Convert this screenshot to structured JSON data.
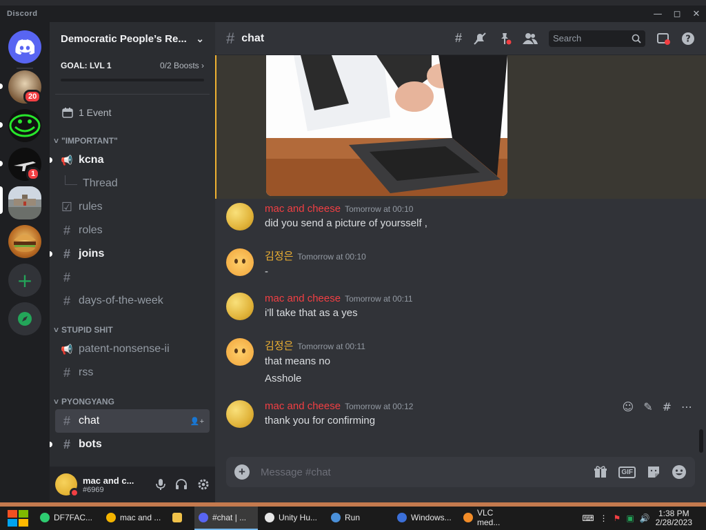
{
  "window": {
    "app_name": "Discord",
    "controls": [
      "minimize",
      "maximize",
      "close"
    ]
  },
  "rail": {
    "servers": [
      {
        "name": "server-1",
        "badge": "20"
      },
      {
        "name": "server-2"
      },
      {
        "name": "server-3",
        "badge": "1"
      },
      {
        "name": "server-4"
      },
      {
        "name": "server-5"
      }
    ]
  },
  "sidebar": {
    "server_name": "Democratic People’s Re...",
    "goal": {
      "label": "GOAL: LVL 1",
      "boosts": "0/2 Boosts",
      "progress": 0
    },
    "event": "1 Event",
    "categories": [
      {
        "name": "\"IMPORTANT\"",
        "channels": [
          {
            "name": "kcna",
            "icon": "announcement-icon",
            "unread": true
          },
          {
            "name": "Thread",
            "icon": "thread-icon"
          },
          {
            "name": "rules",
            "icon": "rules-icon"
          },
          {
            "name": "roles",
            "icon": "hash-icon"
          },
          {
            "name": "joins",
            "icon": "hash-icon",
            "unread": true
          },
          {
            "name": "",
            "icon": "hash-icon"
          },
          {
            "name": "days-of-the-week",
            "icon": "hash-icon"
          }
        ]
      },
      {
        "name": "STUPID SHIT",
        "channels": [
          {
            "name": "patent-nonsense-ii",
            "icon": "announcement-icon"
          },
          {
            "name": "rss",
            "icon": "hash-icon"
          }
        ]
      },
      {
        "name": "PYONGYANG",
        "channels": [
          {
            "name": "chat",
            "icon": "hash-icon",
            "active": true
          },
          {
            "name": "bots",
            "icon": "hash-icon",
            "unread": true
          }
        ]
      }
    ],
    "user": {
      "name": "mac and c...",
      "tag": "#6969"
    }
  },
  "header": {
    "channel": "chat",
    "search_placeholder": "Search"
  },
  "messages": [
    {
      "author": "mac and cheese",
      "author_color": "#f23f43",
      "time": "Tomorrow at 00:10",
      "lines": [
        "did you send a picture of yoursself ,"
      ],
      "avatar": "cheese"
    },
    {
      "author": "김정은",
      "author_color": "#f0b232",
      "time": "Tomorrow at 00:10",
      "lines": [
        "-"
      ],
      "avatar": "face"
    },
    {
      "author": "mac and cheese",
      "author_color": "#f23f43",
      "time": "Tomorrow at 00:11",
      "lines": [
        "i'll take that as a yes"
      ],
      "avatar": "cheese"
    },
    {
      "author": "김정은",
      "author_color": "#f0b232",
      "time": "Tomorrow at 00:11",
      "lines": [
        "that means no",
        "Asshole"
      ],
      "avatar": "face"
    },
    {
      "author": "mac and cheese",
      "author_color": "#f23f43",
      "time": "Tomorrow at 00:12",
      "lines": [
        "thank you for confirming"
      ],
      "avatar": "cheese"
    }
  ],
  "composer": {
    "placeholder": "Message #chat",
    "gif_label": "GIF"
  },
  "taskbar": {
    "tasks": [
      "DF7FAC...",
      "mac and ...",
      "",
      "#chat | ...",
      "Unity Hu...",
      "Run",
      "Windows...",
      "VLC med..."
    ],
    "time": "1:38 PM",
    "date": "2/28/2023"
  },
  "colors": {
    "accent": "#5865f2",
    "mention_highlight": "#f0b232",
    "red": "#f23f43",
    "green": "#23a559"
  }
}
